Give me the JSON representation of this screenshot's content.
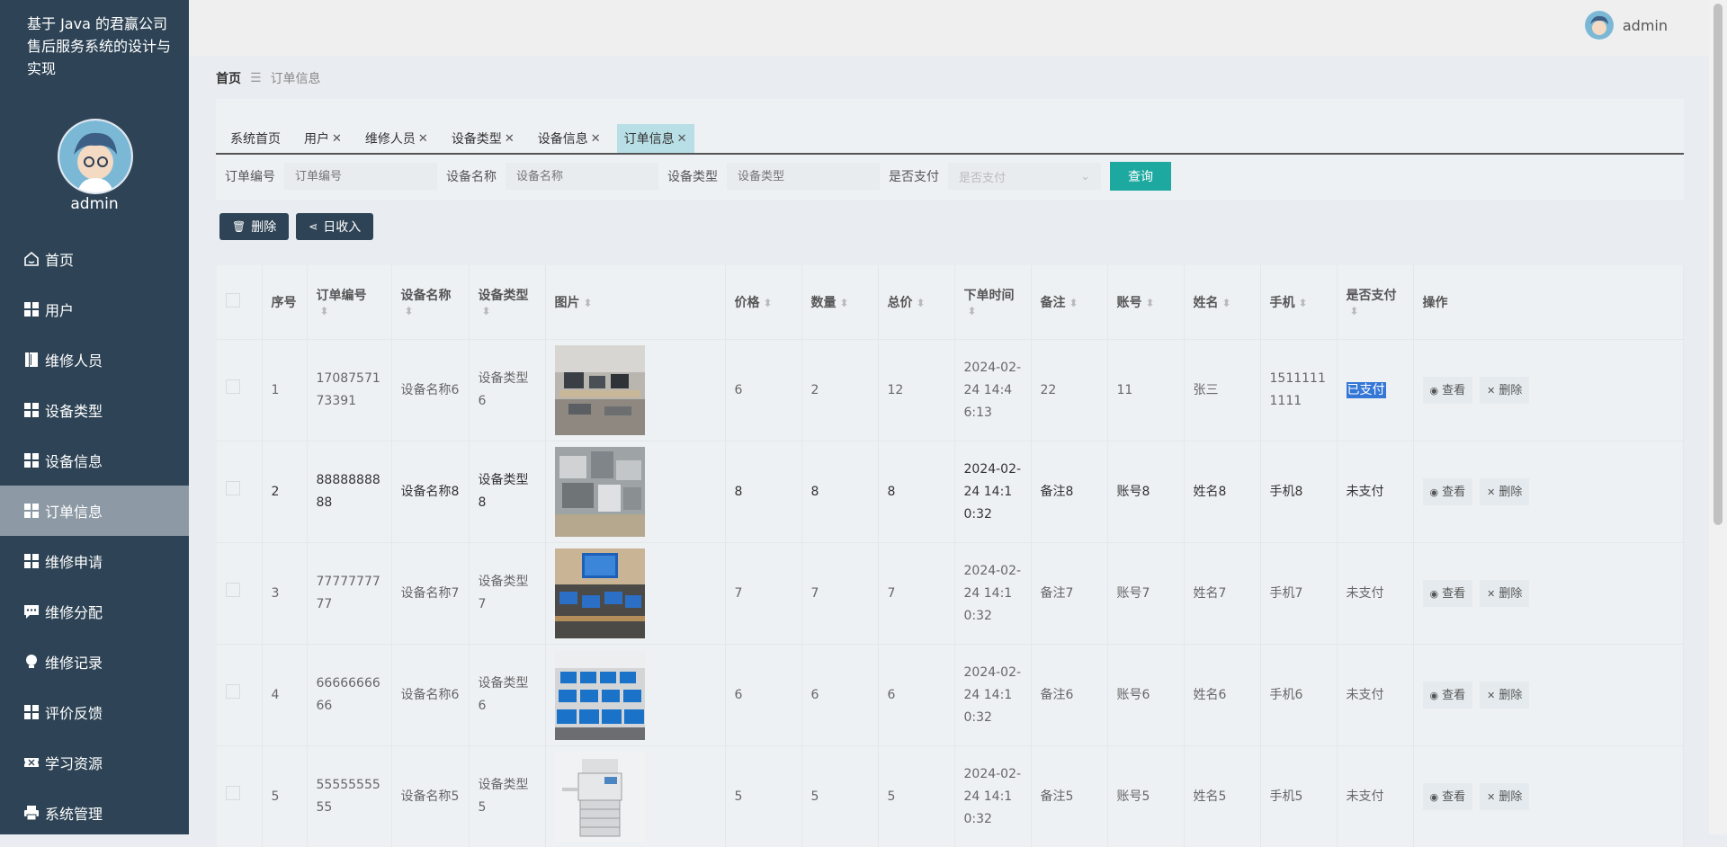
{
  "app": {
    "title": "基于 Java 的君赢公司售后服务系统的设计与实现"
  },
  "sidebar": {
    "user": "admin",
    "items": [
      {
        "label": "首页",
        "icon": "home-icon"
      },
      {
        "label": "用户",
        "icon": "grid-icon"
      },
      {
        "label": "维修人员",
        "icon": "book-icon"
      },
      {
        "label": "设备类型",
        "icon": "grid-icon"
      },
      {
        "label": "设备信息",
        "icon": "grid-icon"
      },
      {
        "label": "订单信息",
        "icon": "grid-icon",
        "active": true
      },
      {
        "label": "维修申请",
        "icon": "grid-icon"
      },
      {
        "label": "维修分配",
        "icon": "chat-icon"
      },
      {
        "label": "维修记录",
        "icon": "bulb-icon"
      },
      {
        "label": "评价反馈",
        "icon": "grid-icon"
      },
      {
        "label": "学习资源",
        "icon": "ticket-icon"
      },
      {
        "label": "系统管理",
        "icon": "printer-icon"
      }
    ]
  },
  "header": {
    "user": "admin"
  },
  "breadcrumb": {
    "home": "首页",
    "current": "订单信息"
  },
  "tabs": [
    {
      "label": "系统首页",
      "closable": false
    },
    {
      "label": "用户",
      "closable": true
    },
    {
      "label": "维修人员",
      "closable": true
    },
    {
      "label": "设备类型",
      "closable": true
    },
    {
      "label": "设备信息",
      "closable": true
    },
    {
      "label": "订单信息",
      "closable": true,
      "active": true
    }
  ],
  "filters": {
    "order_no_label": "订单编号",
    "order_no_placeholder": "订单编号",
    "device_name_label": "设备名称",
    "device_name_placeholder": "设备名称",
    "device_type_label": "设备类型",
    "device_type_placeholder": "设备类型",
    "paid_label": "是否支付",
    "paid_placeholder": "是否支付",
    "query_label": "查询"
  },
  "actions": {
    "delete_label": "删除",
    "daily_income_label": "日收入"
  },
  "table": {
    "columns": [
      "序号",
      "订单编号",
      "设备名称",
      "设备类型",
      "图片",
      "价格",
      "数量",
      "总价",
      "下单时间",
      "备注",
      "账号",
      "姓名",
      "手机",
      "是否支付",
      "操作"
    ],
    "view_label": "查看",
    "delete_label": "删除",
    "rows": [
      {
        "index": "1",
        "order_no": "1708757173391",
        "device_name": "设备名称6",
        "device_type": "设备类型6",
        "price": "6",
        "qty": "2",
        "total": "12",
        "time": "2024-02-24 14:46:13",
        "remark": "22",
        "account": "11",
        "name": "张三",
        "phone": "15111111111",
        "paid": "已支付",
        "highlight": true,
        "image": "lab"
      },
      {
        "index": "2",
        "order_no": "8888888888",
        "device_name": "设备名称8",
        "device_type": "设备类型8",
        "price": "8",
        "qty": "8",
        "total": "8",
        "time": "2024-02-24 14:10:32",
        "remark": "备注8",
        "account": "账号8",
        "name": "姓名8",
        "phone": "手机8",
        "paid": "未支付",
        "image": "pile"
      },
      {
        "index": "3",
        "order_no": "7777777777",
        "device_name": "设备名称7",
        "device_type": "设备类型7",
        "price": "7",
        "qty": "7",
        "total": "7",
        "time": "2024-02-24 14:10:32",
        "remark": "备注7",
        "account": "账号7",
        "name": "姓名7",
        "phone": "手机7",
        "paid": "未支付",
        "image": "desk"
      },
      {
        "index": "4",
        "order_no": "6666666666",
        "device_name": "设备名称6",
        "device_type": "设备类型6",
        "price": "6",
        "qty": "6",
        "total": "6",
        "time": "2024-02-24 14:10:32",
        "remark": "备注6",
        "account": "账号6",
        "name": "姓名6",
        "phone": "手机6",
        "paid": "未支付",
        "image": "monitors"
      },
      {
        "index": "5",
        "order_no": "5555555555",
        "device_name": "设备名称5",
        "device_type": "设备类型5",
        "price": "5",
        "qty": "5",
        "total": "5",
        "time": "2024-02-24 14:10:32",
        "remark": "备注5",
        "account": "账号5",
        "name": "姓名5",
        "phone": "手机5",
        "paid": "未支付",
        "image": "copier"
      }
    ]
  }
}
